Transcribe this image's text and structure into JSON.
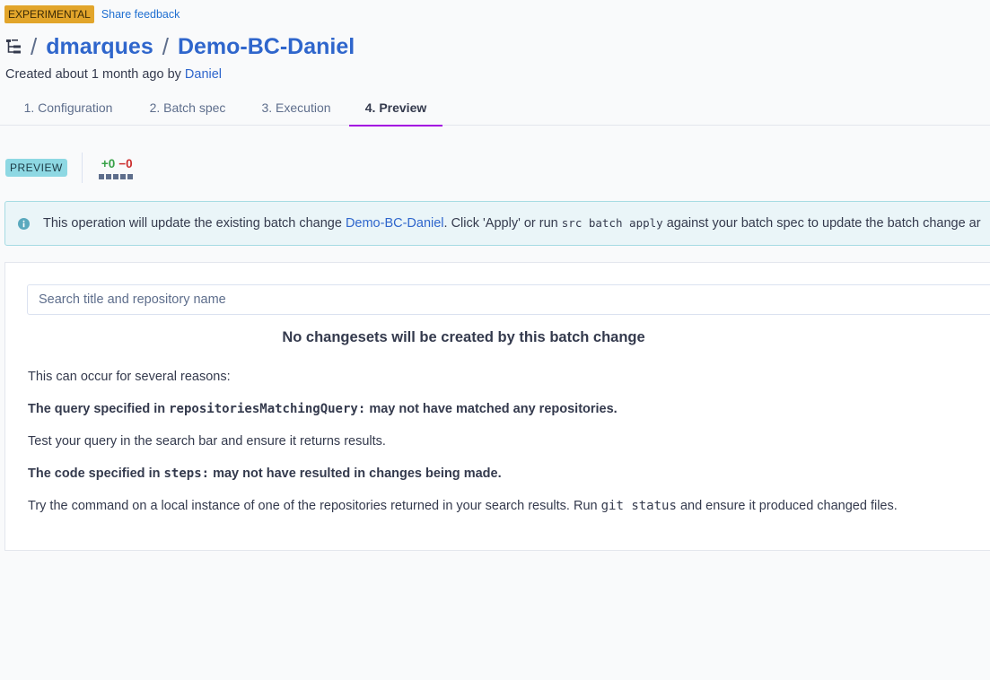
{
  "header": {
    "experimental_badge": "EXPERIMENTAL",
    "share_feedback": "Share feedback",
    "namespace": "dmarques",
    "separator": "/",
    "batch_change_name": "Demo-BC-Daniel",
    "created_prefix": "Created about 1 month ago by",
    "created_by": "Daniel"
  },
  "tabs": [
    {
      "label": "1. Configuration"
    },
    {
      "label": "2. Batch spec"
    },
    {
      "label": "3. Execution"
    },
    {
      "label": "4. Preview",
      "active": true
    }
  ],
  "preview_bar": {
    "badge": "PREVIEW",
    "added": "+0",
    "removed": "−0"
  },
  "alert": {
    "text_1": "This operation will update the existing batch change",
    "link": "Demo-BC-Daniel",
    "text_2": ". Click 'Apply' or run",
    "code": "src batch apply",
    "text_3": "against your batch spec to update the batch change ar"
  },
  "panel": {
    "search_placeholder": "Search title and repository name",
    "heading": "No changesets will be created by this batch change",
    "reasons_intro": "This can occur for several reasons:",
    "reason1_prefix": "The query specified in",
    "reason1_code": "repositoriesMatchingQuery:",
    "reason1_suffix": "may not have matched any repositories.",
    "reason1_help": "Test your query in the search bar and ensure it returns results.",
    "reason2_prefix": "The code specified in",
    "reason2_code": "steps:",
    "reason2_suffix": "may not have resulted in changes being made.",
    "reason2_help_prefix": "Try the command on a local instance of one of the repositories returned in your search results. Run",
    "reason2_help_code": "git status",
    "reason2_help_suffix": "and ensure it produced changed files."
  },
  "colors": {
    "link": "#2f66cc",
    "experimental": "#e2a52b",
    "preview_badge": "#8ed8e3",
    "active_tab": "#a305e1",
    "added": "#37a147",
    "removed": "#cc2e2e"
  }
}
